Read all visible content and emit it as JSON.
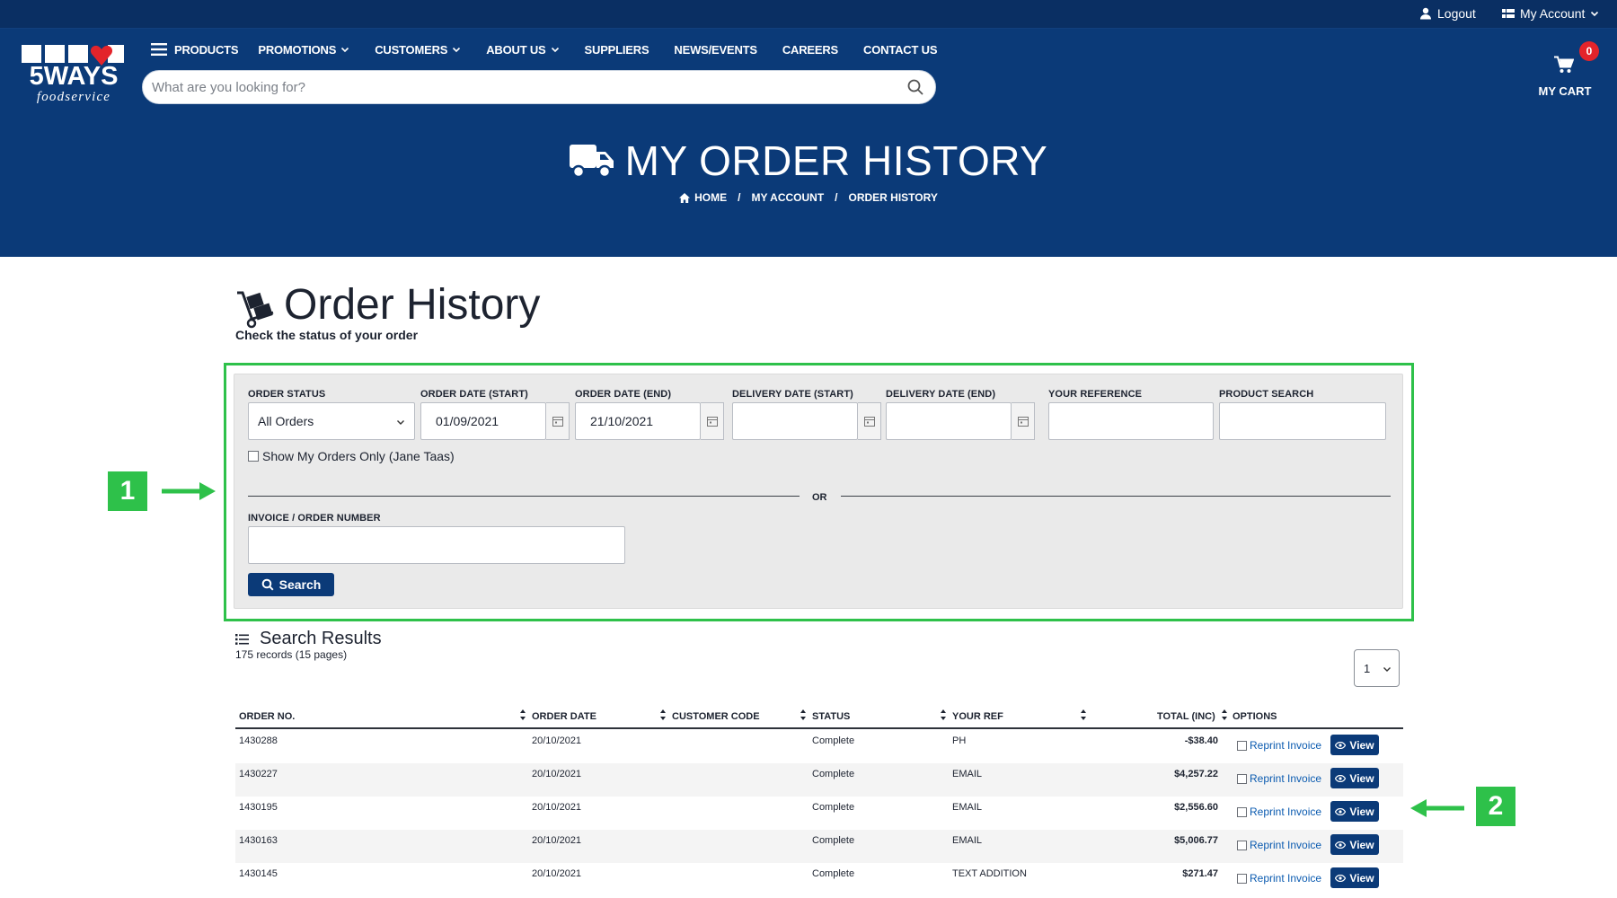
{
  "topbar": {
    "logout_label": "Logout",
    "account_label": "My Account"
  },
  "logo": {
    "word": "5WAYS",
    "sub": "foodservice"
  },
  "nav": {
    "items": [
      {
        "label": "PRODUCTS"
      },
      {
        "label": "PROMOTIONS"
      },
      {
        "label": "CUSTOMERS"
      },
      {
        "label": "ABOUT US"
      },
      {
        "label": "SUPPLIERS"
      },
      {
        "label": "NEWS/EVENTS"
      },
      {
        "label": "CAREERS"
      },
      {
        "label": "CONTACT US"
      }
    ]
  },
  "search": {
    "placeholder": "What are you looking for?"
  },
  "cart": {
    "count": "0",
    "label": "MY CART"
  },
  "hero": {
    "title": "MY ORDER HISTORY",
    "breadcrumbs": [
      "HOME",
      "/",
      "MY ACCOUNT",
      "/",
      "ORDER HISTORY"
    ]
  },
  "page": {
    "title": "Order History",
    "subtitle": "Check the status of your order"
  },
  "filters": {
    "order_status_label": "ORDER STATUS",
    "order_status_value": "All Orders",
    "order_start_label": "ORDER DATE (START)",
    "order_start_value": "01/09/2021",
    "order_end_label": "ORDER DATE (END)",
    "order_end_value": "21/10/2021",
    "delivery_start_label": "DELIVERY DATE (START)",
    "delivery_end_label": "DELIVERY DATE (END)",
    "your_ref_label": "YOUR REFERENCE",
    "product_search_label": "PRODUCT SEARCH",
    "show_mine_label": "Show My Orders Only (Jane Taas)",
    "or_label": "OR",
    "invoice_label": "INVOICE / ORDER NUMBER",
    "search_button": "Search"
  },
  "annotations": {
    "one": "1",
    "two": "2"
  },
  "results": {
    "title": "Search Results",
    "count": "175 records (15 pages)",
    "page_selected": "1",
    "columns": [
      "ORDER NO.",
      "ORDER DATE",
      "CUSTOMER CODE",
      "STATUS",
      "YOUR REF",
      "TOTAL (INC)",
      "OPTIONS"
    ],
    "reprint_label": "Reprint Invoice",
    "view_label": "View",
    "rows": [
      {
        "order_no": "1430288",
        "date": "20/10/2021",
        "customer_code": "",
        "status": "Complete",
        "ref": "PH",
        "total": "-$38.40"
      },
      {
        "order_no": "1430227",
        "date": "20/10/2021",
        "customer_code": "",
        "status": "Complete",
        "ref": "EMAIL",
        "total": "$4,257.22"
      },
      {
        "order_no": "1430195",
        "date": "20/10/2021",
        "customer_code": "",
        "status": "Complete",
        "ref": "EMAIL",
        "total": "$2,556.60"
      },
      {
        "order_no": "1430163",
        "date": "20/10/2021",
        "customer_code": "",
        "status": "Complete",
        "ref": "EMAIL",
        "total": "$5,006.77"
      },
      {
        "order_no": "1430145",
        "date": "20/10/2021",
        "customer_code": "",
        "status": "Complete",
        "ref": "TEXT ADDITION",
        "total": "$271.47"
      }
    ]
  },
  "colors": {
    "brand_blue": "#0b3a78",
    "highlight_green": "#2ec14a",
    "badge_red": "#e3242b"
  }
}
